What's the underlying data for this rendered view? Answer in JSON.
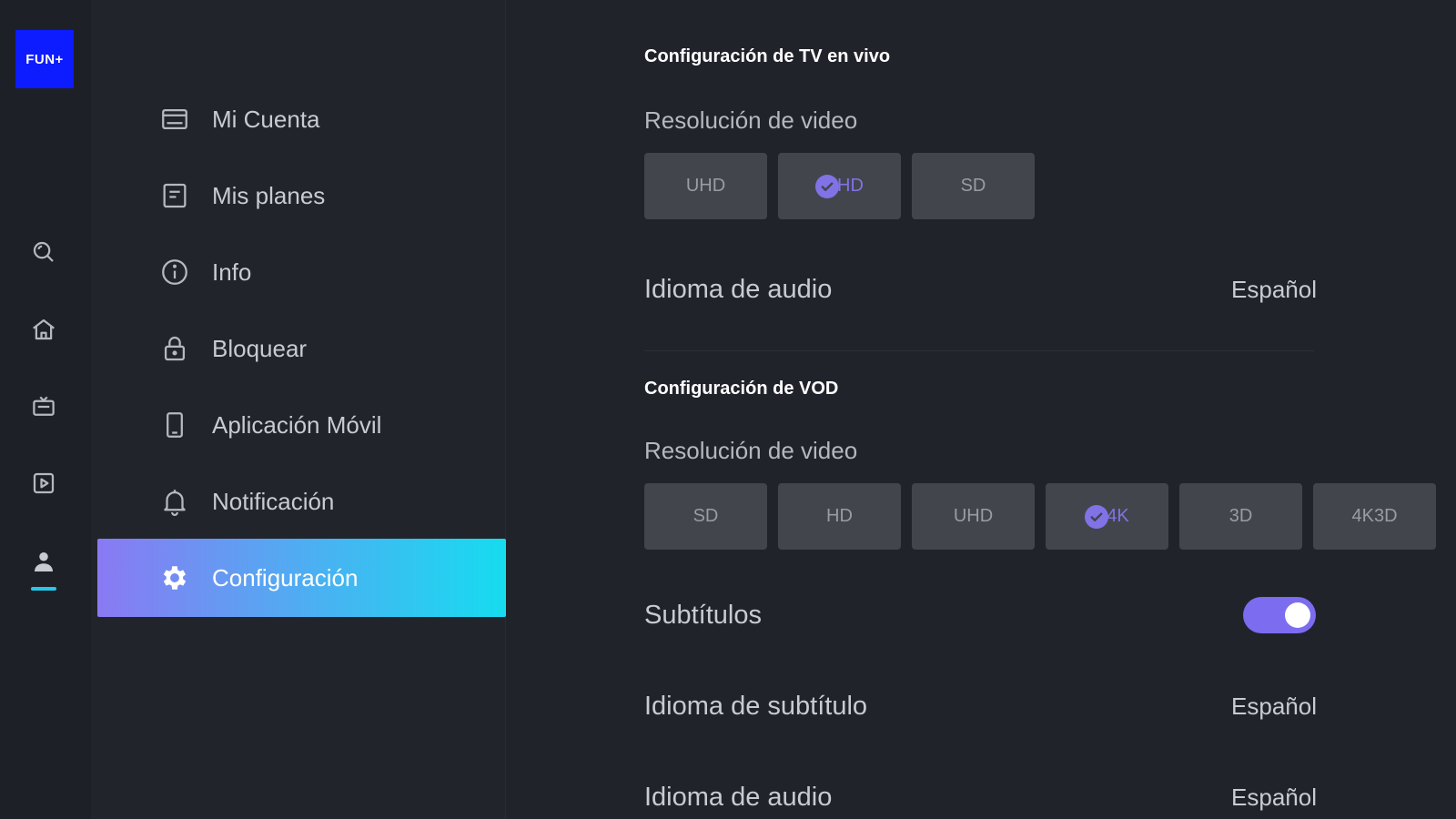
{
  "logo": {
    "text": "FUN+"
  },
  "rail": {
    "icons": [
      "search-icon",
      "home-icon",
      "tv-icon",
      "play-icon",
      "profile-icon"
    ],
    "accent": "#25c8e8"
  },
  "menu": {
    "items": [
      {
        "label": "Mi Cuenta",
        "icon": "account-icon"
      },
      {
        "label": "Mis planes",
        "icon": "plans-icon"
      },
      {
        "label": "Info",
        "icon": "info-icon"
      },
      {
        "label": "Bloquear",
        "icon": "lock-icon"
      },
      {
        "label": "Aplicación Móvil",
        "icon": "mobile-icon"
      },
      {
        "label": "Notificación",
        "icon": "bell-icon"
      },
      {
        "label": "Configuración",
        "icon": "gear-icon",
        "active": true
      }
    ]
  },
  "live": {
    "title": "Configuración de TV en vivo",
    "resolution_label": "Resolución de video",
    "options": [
      "UHD",
      "HD",
      "SD"
    ],
    "selected": "HD",
    "audio_label": "Idioma de audio",
    "audio_value": "Español"
  },
  "vod": {
    "title": "Configuración de VOD",
    "resolution_label": "Resolución de video",
    "options": [
      "SD",
      "HD",
      "UHD",
      "4K",
      "3D",
      "4K3D"
    ],
    "selected": "4K",
    "subtitles_label": "Subtítulos",
    "subtitles_on": true,
    "subtitle_lang_label": "Idioma de subtítulo",
    "subtitle_lang_value": "Español",
    "audio_label": "Idioma de audio",
    "audio_value": "Español"
  },
  "colors": {
    "background": "#21232b",
    "accent_purple": "#8172e6",
    "toggle": "#7b6cf0",
    "logo_blue": "#0d1bff"
  }
}
